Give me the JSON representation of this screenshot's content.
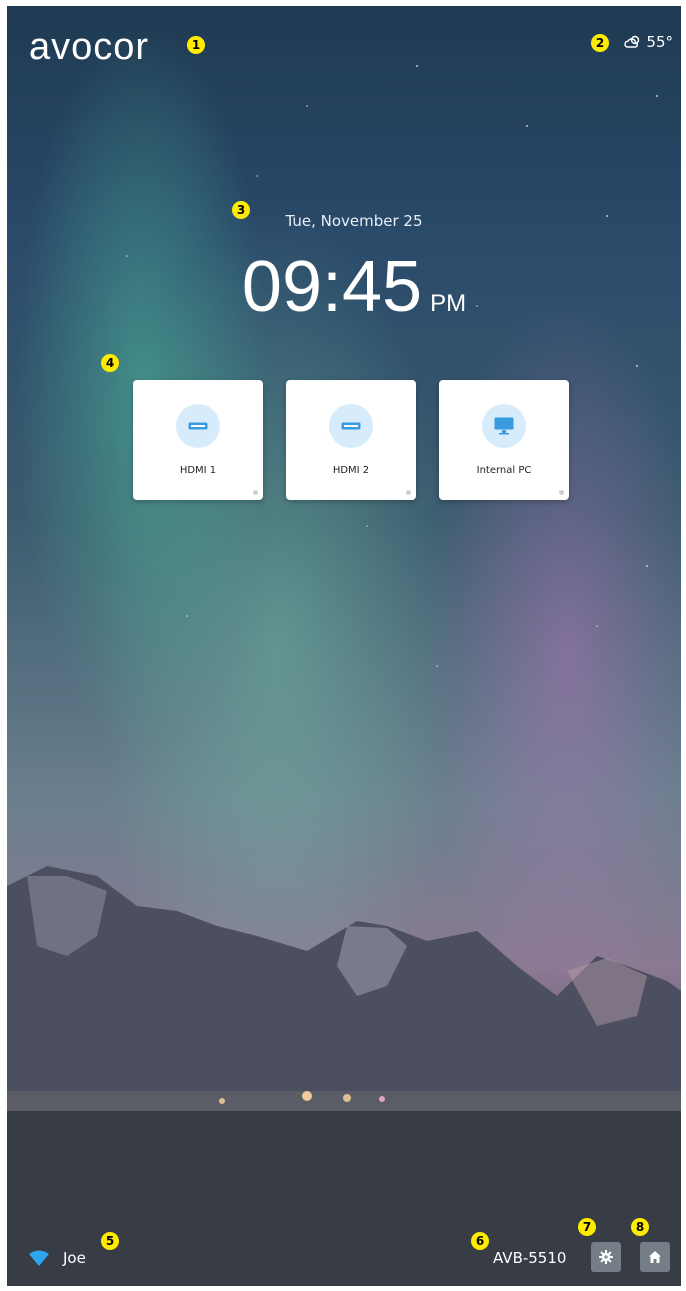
{
  "header": {
    "logo_text": "avocor",
    "weather": {
      "temperature": "55°",
      "icon": "cloud-sun-icon"
    }
  },
  "clock": {
    "date": "Tue, November 25",
    "time": "09:45",
    "period": "PM"
  },
  "inputs": [
    {
      "label": "HDMI 1",
      "icon": "hdmi-icon"
    },
    {
      "label": "HDMI 2",
      "icon": "hdmi-icon"
    },
    {
      "label": "Internal PC",
      "icon": "monitor-icon"
    }
  ],
  "footer": {
    "wifi_icon": "wifi-icon",
    "user_name": "Joe",
    "device_name": "AVB-5510",
    "settings_icon": "gear-icon",
    "home_icon": "home-icon"
  },
  "annotations": [
    "1",
    "2",
    "3",
    "4",
    "5",
    "6",
    "7",
    "8"
  ],
  "colors": {
    "accent_icon": "#3a9be0",
    "icon_bg": "#d7ecfb",
    "marker": "#ffeb00"
  }
}
